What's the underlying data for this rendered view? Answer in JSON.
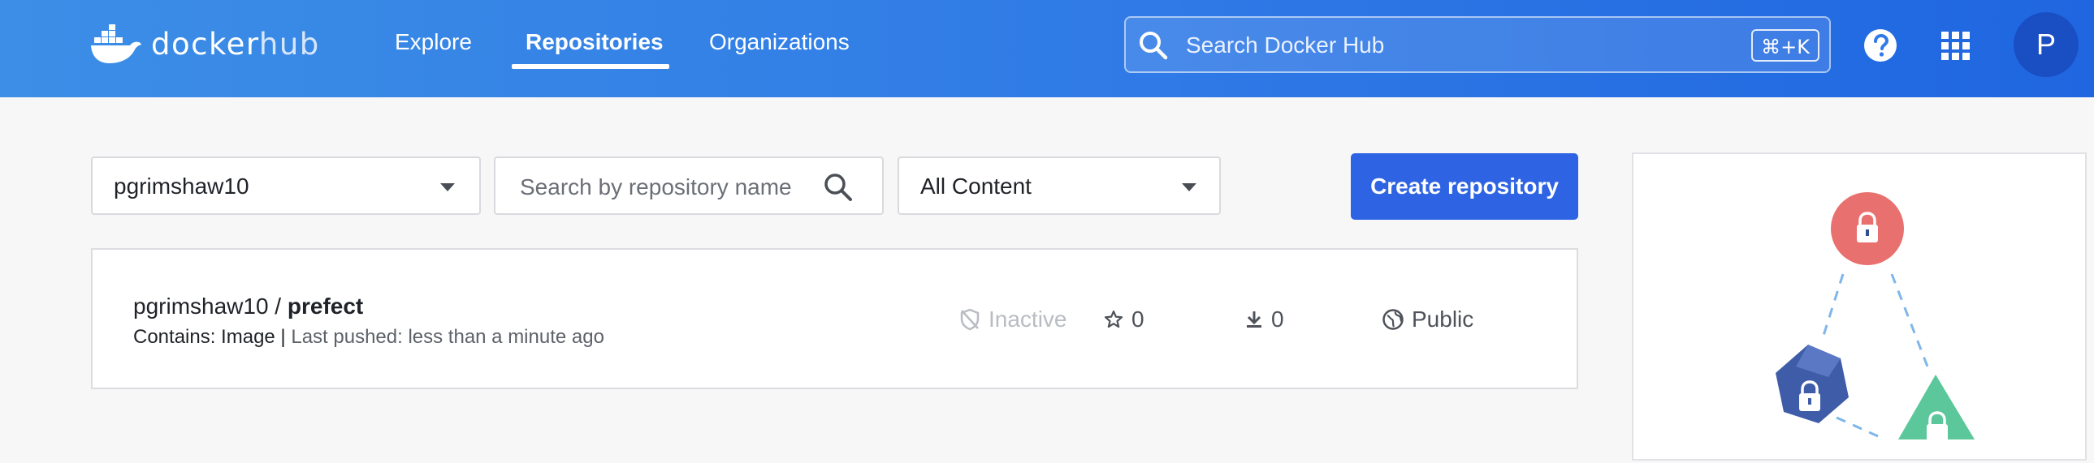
{
  "brand": {
    "docker": "docker",
    "hub": "hub"
  },
  "nav": {
    "explore": "Explore",
    "repositories": "Repositories",
    "organizations": "Organizations"
  },
  "search": {
    "placeholder": "Search Docker Hub",
    "shortcut": "⌘+K"
  },
  "user": {
    "avatar_initial": "P"
  },
  "filters": {
    "namespace": "pgrimshaw10",
    "repo_search_placeholder": "Search by repository name",
    "content_filter": "All Content"
  },
  "actions": {
    "create_repository": "Create repository"
  },
  "repository": {
    "owner": "pgrimshaw10 / ",
    "name": "prefect",
    "contains": "Contains: Image | ",
    "last_pushed": "Last pushed: less than a minute ago",
    "status": "Inactive",
    "stars": "0",
    "pulls": "0",
    "visibility": "Public"
  },
  "colors": {
    "header_start": "#3c8ee6",
    "header_end": "#1f66e0",
    "primary_button": "#2e64e3",
    "avatar": "#1a4fc4"
  },
  "icons": [
    "docker-whale-icon",
    "search-icon",
    "help-icon",
    "apps-grid-icon",
    "caret-down-icon",
    "inactive-shield-icon",
    "star-icon",
    "download-icon",
    "globe-icon",
    "lock-icon"
  ]
}
